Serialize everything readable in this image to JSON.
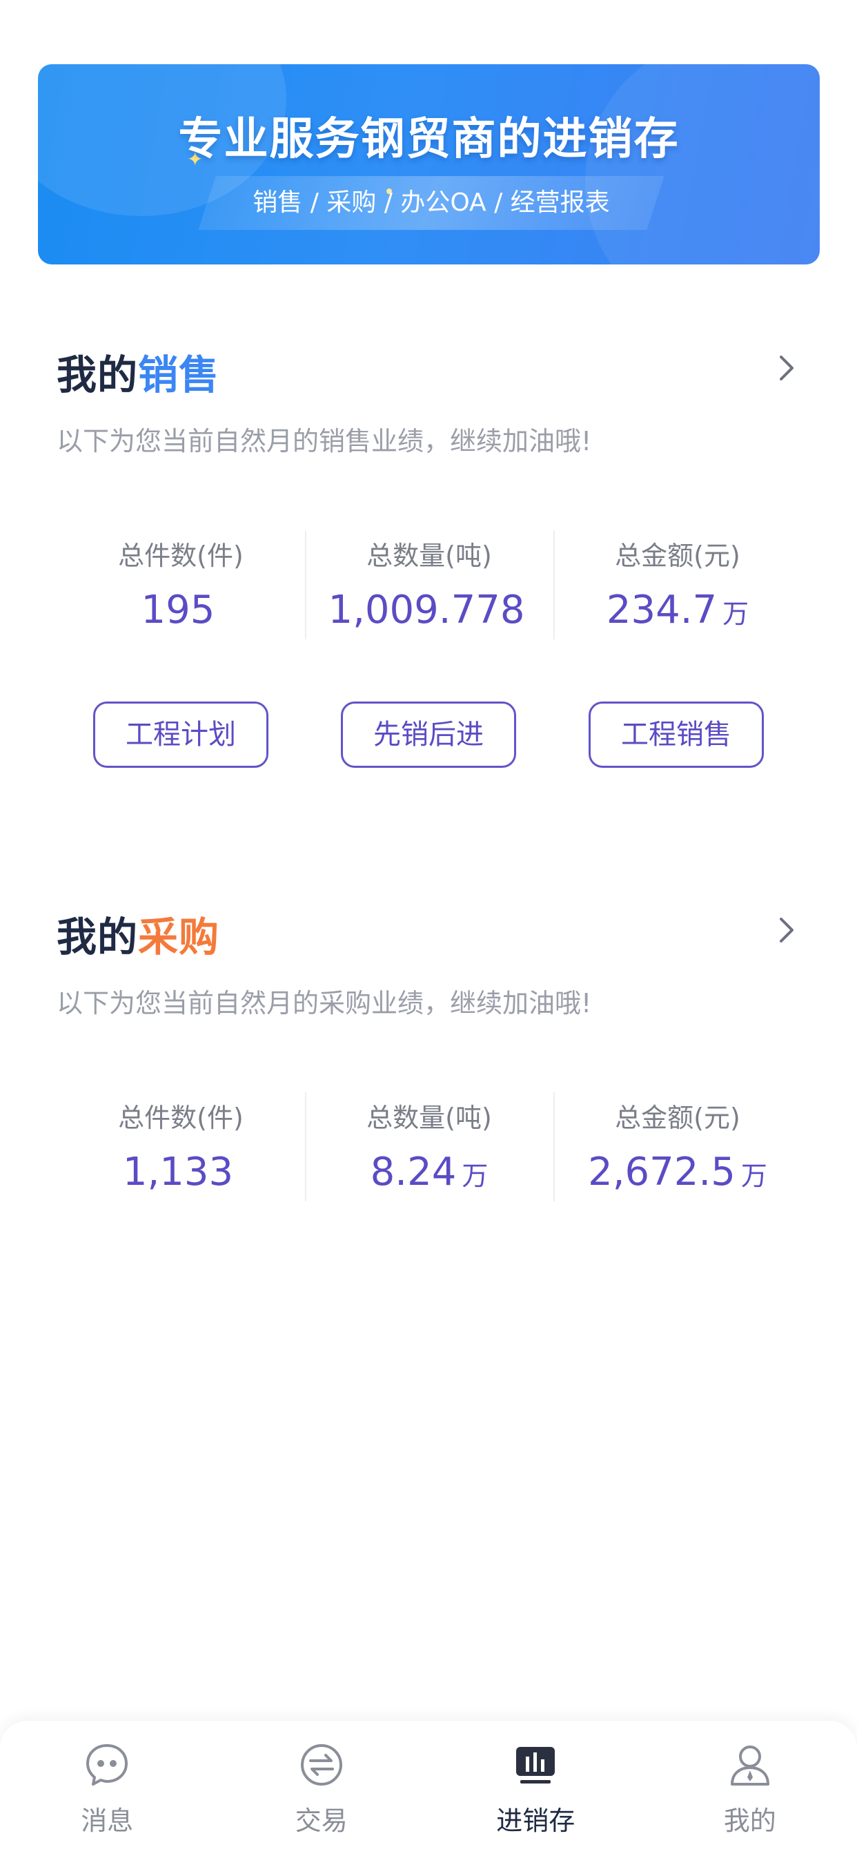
{
  "banner": {
    "title": "专业服务钢贸商的进销存",
    "subtitle": "销售 / 采购 / 办公OA / 经营报表"
  },
  "sales": {
    "title_prefix": "我的",
    "title_accent": "销售",
    "description": "以下为您当前自然月的销售业绩，继续加油哦!",
    "stats": [
      {
        "label": "总件数(件)",
        "value": "195",
        "unit": ""
      },
      {
        "label": "总数量(吨)",
        "value": "1,009.778",
        "unit": ""
      },
      {
        "label": "总金额(元)",
        "value": "234.7",
        "unit": "万"
      }
    ],
    "buttons": [
      "工程计划",
      "先销后进",
      "工程销售"
    ]
  },
  "purchase": {
    "title_prefix": "我的",
    "title_accent": "采购",
    "description": "以下为您当前自然月的采购业绩，继续加油哦!",
    "stats": [
      {
        "label": "总件数(件)",
        "value": "1,133",
        "unit": ""
      },
      {
        "label": "总数量(吨)",
        "value": "8.24",
        "unit": "万"
      },
      {
        "label": "总金额(元)",
        "value": "2,672.5",
        "unit": "万"
      }
    ]
  },
  "tabbar": {
    "items": [
      {
        "label": "消息",
        "icon": "message-icon"
      },
      {
        "label": "交易",
        "icon": "exchange-icon"
      },
      {
        "label": "进销存",
        "icon": "inventory-chart-icon"
      },
      {
        "label": "我的",
        "icon": "profile-icon"
      }
    ],
    "active_index": 2
  },
  "colors": {
    "accent_blue": "#3b86f3",
    "accent_orange": "#f47a3b",
    "value_purple": "#5a4cc4",
    "banner_blue": "#2f8ff6"
  }
}
